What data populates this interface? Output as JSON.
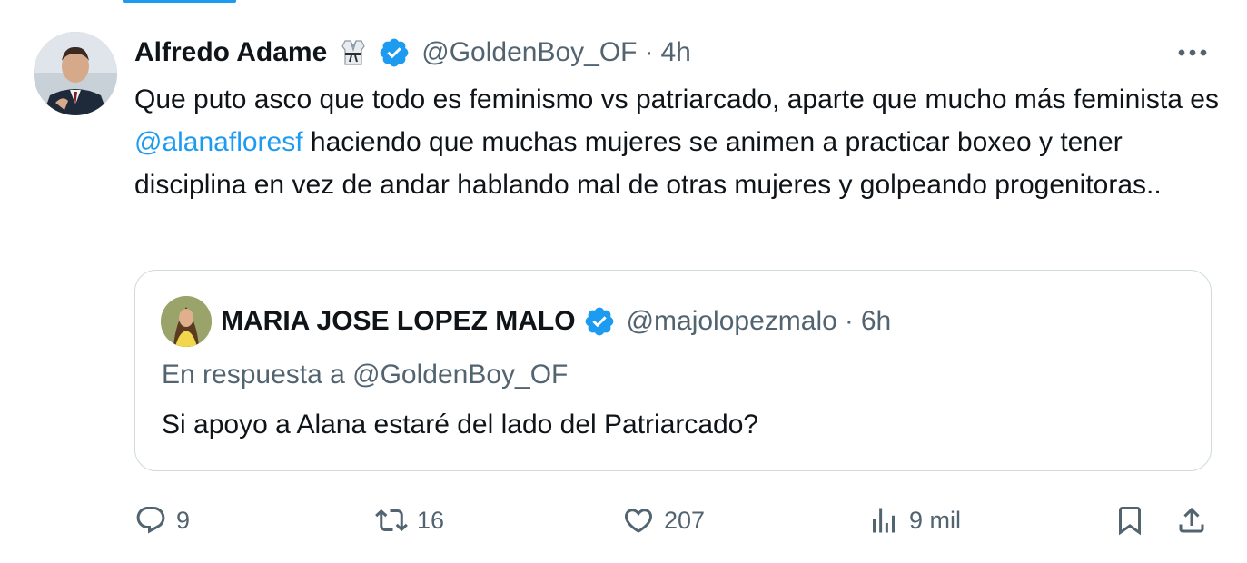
{
  "tweet": {
    "author_name": "Alfredo Adame",
    "emoji_badge": "martial-arts-uniform-emoji",
    "handle": "@GoldenBoy_OF",
    "separator": "·",
    "time": "4h",
    "text_before_mention": "Que puto asco que todo es feminismo vs patriarcado, aparte que mucho más feminista es ",
    "mention": "@alanafloresf",
    "text_after_mention": " haciendo que muchas mujeres se animen a practicar boxeo y tener disciplina en vez de andar hablando mal de otras mujeres y golpeando progenitoras.."
  },
  "quote": {
    "author_name": "MARIA JOSE LOPEZ MALO",
    "handle": "@majolopezmalo",
    "separator": "·",
    "time": "6h",
    "reply_to": "En respuesta a @GoldenBoy_OF",
    "text": "Si apoyo a Alana estaré del lado del Patriarcado?"
  },
  "actions": {
    "replies": "9",
    "retweets": "16",
    "likes": "207",
    "views": "9 mil"
  },
  "colors": {
    "accent": "#1d9bf0",
    "secondary_text": "#536471",
    "primary_text": "#0f1419",
    "border": "#cfd9de"
  }
}
